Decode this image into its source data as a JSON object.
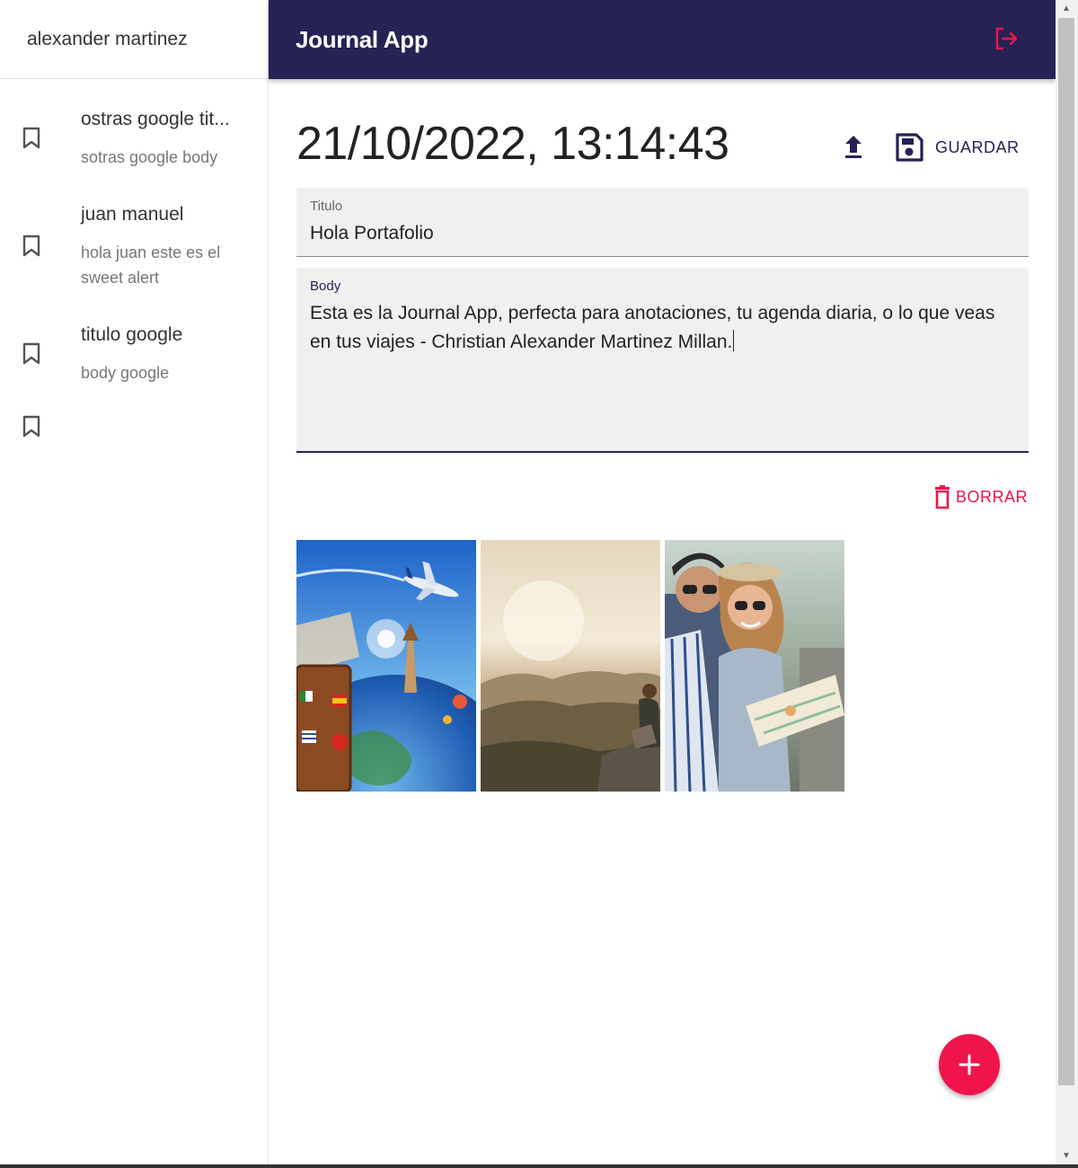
{
  "sidebar": {
    "user_name": "alexander martinez",
    "entries": [
      {
        "title": "ostras google tit...",
        "body": "sotras google body"
      },
      {
        "title": "juan manuel",
        "body": "hola juan este es el sweet alert"
      },
      {
        "title": "titulo google",
        "body": "body google"
      },
      {
        "title": "",
        "body": ""
      }
    ]
  },
  "header": {
    "app_title": "Journal App"
  },
  "note": {
    "date": "21/10/2022, 13:14:43",
    "save_label": "GUARDAR",
    "title_label": "Titulo",
    "title_value": "Hola Portafolio",
    "body_label": "Body",
    "body_value": "Esta es la Journal App, perfecta para anotaciones, tu agenda diaria, o lo que veas en tus viajes - Christian Alexander Martinez Millan.",
    "delete_label": "BORRAR"
  },
  "gallery": {
    "images": [
      {
        "name": "travel-globe-suitcase-image"
      },
      {
        "name": "mountain-view-hiker-image"
      },
      {
        "name": "couple-with-map-image"
      }
    ]
  },
  "colors": {
    "primary": "#262254",
    "accent": "#f0144c",
    "field_bg": "#f0f0f0"
  },
  "icons": {
    "logout": "logout-icon",
    "bookmark": "bookmark-icon",
    "upload": "upload-icon",
    "save": "save-icon",
    "delete": "trash-icon",
    "add": "plus-icon"
  }
}
